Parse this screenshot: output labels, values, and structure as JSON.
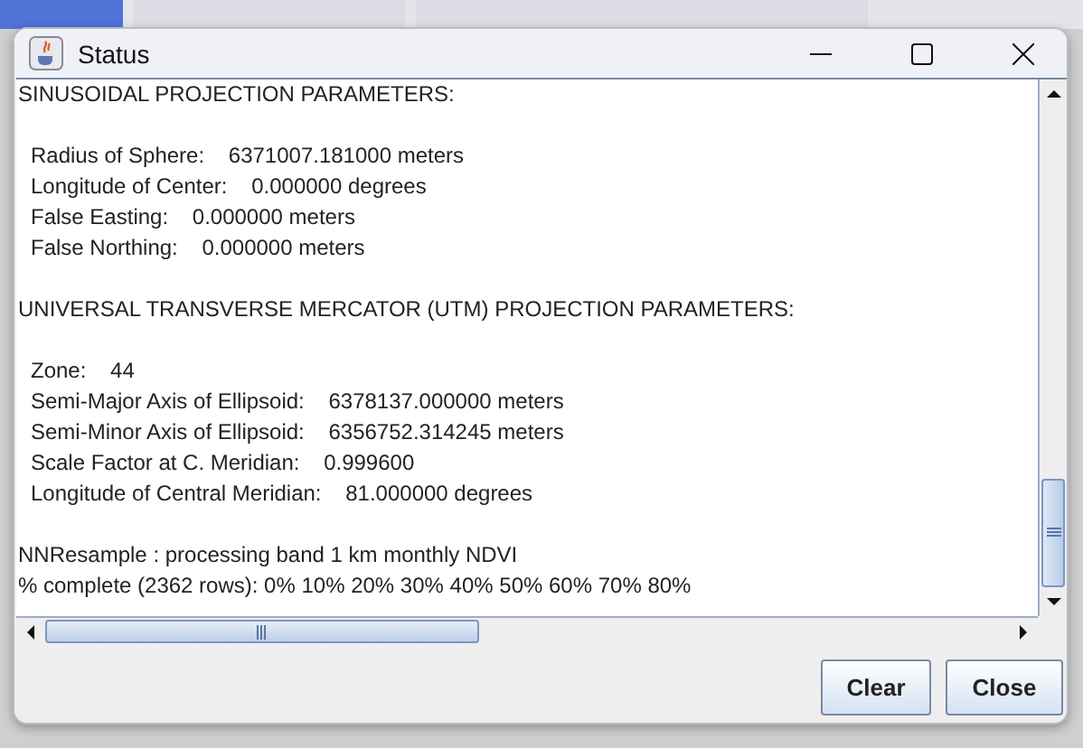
{
  "window": {
    "title": "Status"
  },
  "log": [
    {
      "kind": "heading",
      "text": "SINUSOIDAL PROJECTION PARAMETERS:"
    },
    {
      "kind": "blank"
    },
    {
      "kind": "param",
      "label": "Radius of Sphere:",
      "value": "6371007.181000 meters"
    },
    {
      "kind": "param",
      "label": "Longitude of Center:",
      "value": "0.000000 degrees"
    },
    {
      "kind": "param",
      "label": "False Easting:",
      "value": "0.000000 meters"
    },
    {
      "kind": "param",
      "label": "False Northing:",
      "value": "0.000000 meters"
    },
    {
      "kind": "blank"
    },
    {
      "kind": "heading",
      "text": "UNIVERSAL TRANSVERSE MERCATOR (UTM) PROJECTION PARAMETERS:"
    },
    {
      "kind": "blank"
    },
    {
      "kind": "param",
      "label": "Zone:",
      "value": "44"
    },
    {
      "kind": "param",
      "label": "Semi-Major Axis of Ellipsoid:",
      "value": "6378137.000000 meters"
    },
    {
      "kind": "param",
      "label": "Semi-Minor Axis of Ellipsoid:",
      "value": "6356752.314245 meters"
    },
    {
      "kind": "param",
      "label": "Scale Factor at C. Meridian:",
      "value": "0.999600"
    },
    {
      "kind": "param",
      "label": "Longitude of Central Meridian:",
      "value": "81.000000 degrees"
    },
    {
      "kind": "blank"
    },
    {
      "kind": "heading",
      "text": "NNResample : processing band 1 km monthly NDVI"
    },
    {
      "kind": "heading",
      "text": "% complete (2362 rows): 0% 10% 20% 30% 40% 50% 60% 70% 80%"
    }
  ],
  "buttons": [
    "Clear",
    "Close"
  ],
  "background_tabs": [
    {
      "selected": true
    },
    {
      "selected": false
    },
    {
      "selected": false
    }
  ]
}
